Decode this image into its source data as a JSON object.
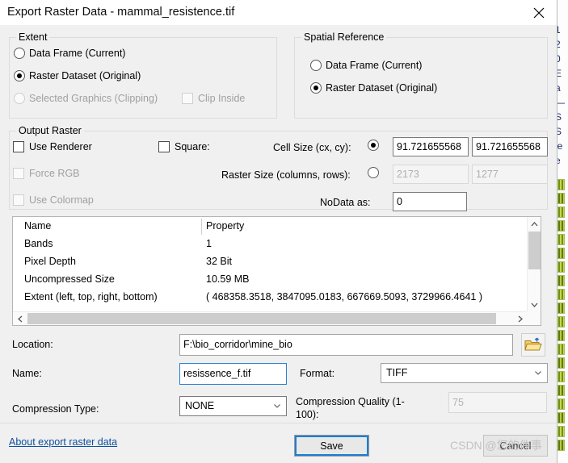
{
  "window": {
    "title": "Export Raster Data - mammal_resistence.tif",
    "close_label": "✕"
  },
  "extent": {
    "legend": "Extent",
    "options": [
      {
        "label": "Data Frame (Current)",
        "selected": false,
        "disabled": false
      },
      {
        "label": "Raster Dataset (Original)",
        "selected": true,
        "disabled": false
      },
      {
        "label": "Selected Graphics (Clipping)",
        "selected": false,
        "disabled": true
      }
    ],
    "clip_inside": {
      "label": "Clip Inside",
      "checked": false,
      "disabled": true
    }
  },
  "spatial_reference": {
    "legend": "Spatial Reference",
    "options": [
      {
        "label": "Data Frame (Current)",
        "selected": false
      },
      {
        "label": "Raster Dataset (Original)",
        "selected": true
      }
    ]
  },
  "output_raster": {
    "legend": "Output Raster",
    "use_renderer": {
      "label": "Use Renderer",
      "checked": false,
      "disabled": false
    },
    "force_rgb": {
      "label": "Force RGB",
      "checked": false,
      "disabled": true
    },
    "use_colormap": {
      "label": "Use Colormap",
      "checked": false,
      "disabled": true
    },
    "square": {
      "label": "Square:",
      "checked": false,
      "disabled": false
    },
    "cell_size": {
      "label": "Cell Size (cx, cy):",
      "selected": true,
      "cx": "91.721655568",
      "cy": "91.721655568"
    },
    "raster_size": {
      "label": "Raster Size (columns, rows):",
      "selected": false,
      "columns": "2173",
      "rows": "1277"
    },
    "nodata": {
      "label": "NoData as:",
      "value": "0"
    }
  },
  "properties": {
    "columns": [
      "Name",
      "Property"
    ],
    "rows": [
      {
        "name": "Bands",
        "value": "1"
      },
      {
        "name": "Pixel Depth",
        "value": "32 Bit"
      },
      {
        "name": "Uncompressed Size",
        "value": "10.59 MB"
      },
      {
        "name": "Extent (left, top, right, bottom)",
        "value": "( 468358.3518, 3847095.0183, 667669.5093, 3729966.4641 )"
      }
    ]
  },
  "output": {
    "location_label": "Location:",
    "location_value": "F:\\bio_corridor\\mine_bio",
    "browse_icon": "folder-open-icon",
    "name_label": "Name:",
    "name_value": "resissence_f.tif",
    "format_label": "Format:",
    "format_value": "TIFF",
    "compression_type_label": "Compression Type:",
    "compression_type_value": "NONE",
    "compression_quality_label": "Compression Quality (1-100):",
    "compression_quality_value": "75"
  },
  "footer": {
    "about_link": "About export raster data",
    "save_label": "Save",
    "cancel_label": "Cancel"
  },
  "watermark": {
    "text": "CSDN @您的件事"
  },
  "background_window": {
    "text_fragment": "1\n2\n0\nE\na\n—\nS\nS\nle\ne"
  },
  "colors": {
    "accent": "#1a7fd4",
    "link": "#0b4f9e",
    "dialog_bg": "#f0f0f0",
    "field_bg": "#ffffff",
    "disabled_text": "#a0a0a0"
  }
}
